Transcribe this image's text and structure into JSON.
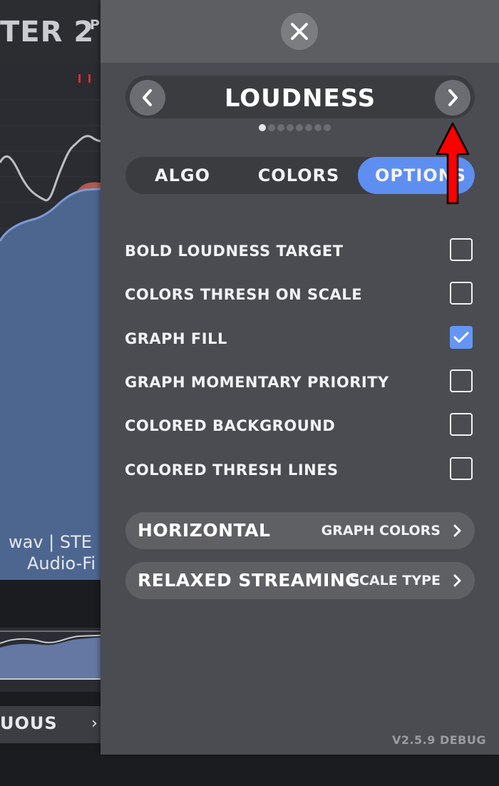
{
  "background": {
    "title": "TER 2",
    "title_suffix": "P",
    "file_line_1": "wav | STE",
    "file_line_2": "Audio-Fi",
    "mode_label": "UOUS"
  },
  "panel": {
    "page_title": "LOUDNESS",
    "page_count": 8,
    "active_page": 0,
    "tabs": [
      {
        "label": "ALGO",
        "active": false
      },
      {
        "label": "COLORS",
        "active": false
      },
      {
        "label": "OPTIONS",
        "active": true
      }
    ],
    "options": [
      {
        "label": "BOLD LOUDNESS TARGET",
        "checked": false
      },
      {
        "label": "COLORS THRESH ON SCALE",
        "checked": false
      },
      {
        "label": "GRAPH FILL",
        "checked": true
      },
      {
        "label": "GRAPH MOMENTARY PRIORITY",
        "checked": false
      },
      {
        "label": "COLORED BACKGROUND",
        "checked": false
      },
      {
        "label": "COLORED THRESH LINES",
        "checked": false
      }
    ],
    "selectors": [
      {
        "value": "HORIZONTAL",
        "label": "GRAPH COLORS"
      },
      {
        "value": "RELAXED STREAMING",
        "label": "SCALE TYPE"
      }
    ],
    "version": "V2.5.9 DEBUG"
  },
  "colors": {
    "accent": "#5e8ff0",
    "panel_bg": "#4a4c51",
    "annotation": "#ff0000"
  },
  "icons": {
    "close": "close-icon",
    "prev": "chevron-left-icon",
    "next": "chevron-right-icon",
    "check": "check-icon",
    "annotation": "red-arrow-up"
  }
}
